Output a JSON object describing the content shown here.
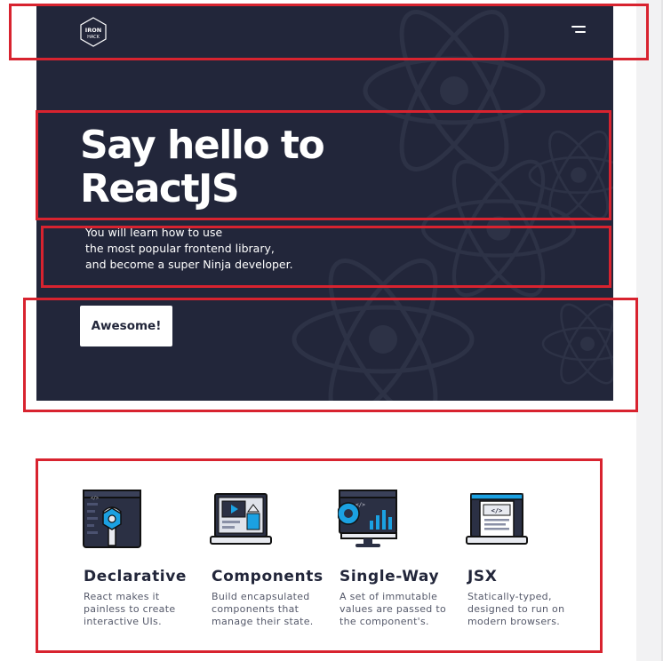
{
  "colors": {
    "hero_background": "#22263a",
    "text_light": "#ffffff",
    "text_dark": "#22263a",
    "text_muted": "#55596a",
    "icon_accent": "#1ba1e2",
    "annotation_outline": "#d8232f"
  },
  "nav": {
    "logo_text": [
      "IRON",
      "HACK"
    ],
    "menu_icon": "hamburger-menu-icon"
  },
  "hero": {
    "title_lines": [
      "Say hello to",
      "ReactJS"
    ],
    "subtitle_lines": [
      "You will learn how to use",
      "the most popular frontend library,",
      "and become a super Ninja developer."
    ],
    "cta_label": "Awesome!",
    "background_icon": "react-atom-icon"
  },
  "features": [
    {
      "icon": "code-gear-wrench-icon",
      "title": "Declarative",
      "description_lines": [
        "React makes it",
        "painless to create",
        "interactive UIs."
      ]
    },
    {
      "icon": "laptop-components-icon",
      "title": "Components",
      "description_lines": [
        "Build encapsulated",
        "components that",
        "manage their state."
      ]
    },
    {
      "icon": "monitor-gear-chart-icon",
      "title": "Single-Way",
      "description_lines": [
        "A set of immutable",
        "values are passed to",
        "the component's."
      ]
    },
    {
      "icon": "laptop-code-document-icon",
      "title": "JSX",
      "description_lines": [
        "Statically-typed,",
        "designed to run on",
        "modern browsers."
      ]
    }
  ]
}
